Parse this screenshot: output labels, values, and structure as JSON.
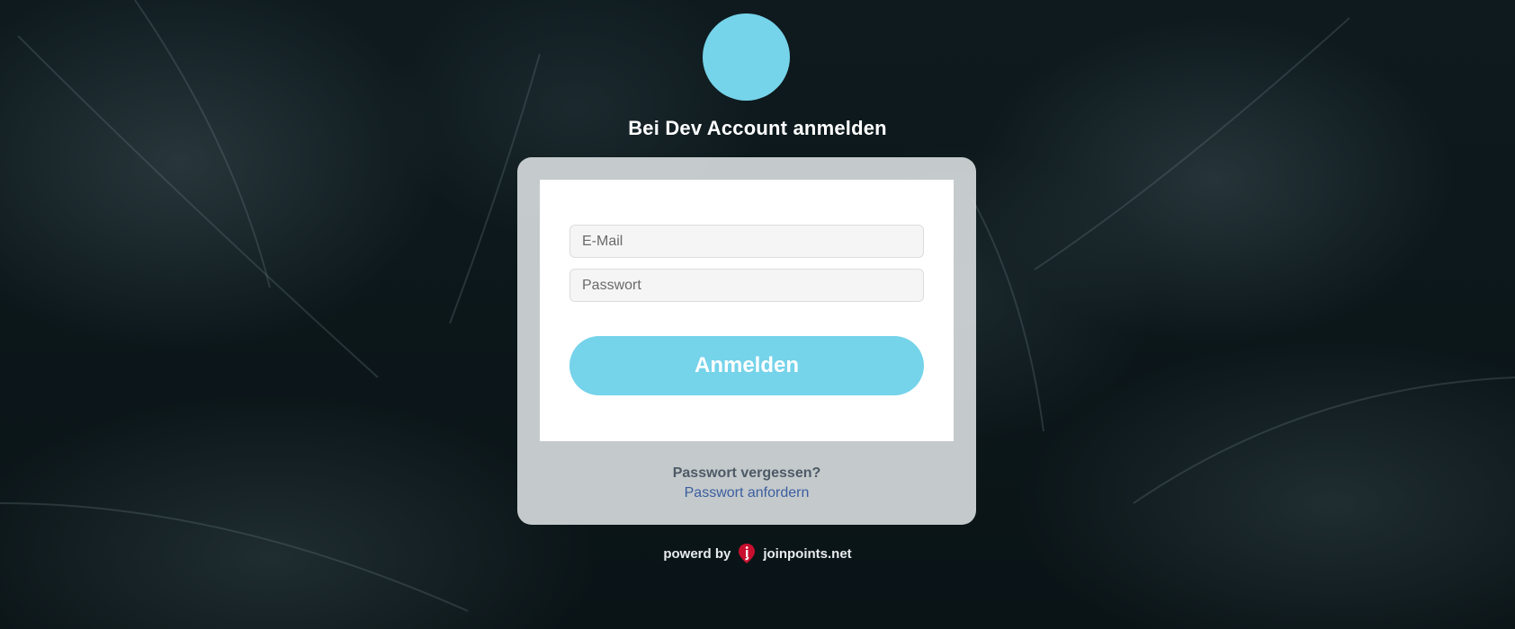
{
  "page": {
    "title": "Bei Dev Account anmelden"
  },
  "form": {
    "email_placeholder": "E-Mail",
    "password_placeholder": "Passwort",
    "submit_label": "Anmelden"
  },
  "forgot": {
    "question": "Passwort vergessen?",
    "link_label": "Passwort anfordern"
  },
  "footer": {
    "powered_by": "powerd by",
    "brand": "joinpoints.net",
    "logo_icon": "joinpoints-logo-icon"
  },
  "colors": {
    "accent": "#75d3ea",
    "link": "#3b5ea0",
    "logo": "#c8102e"
  }
}
